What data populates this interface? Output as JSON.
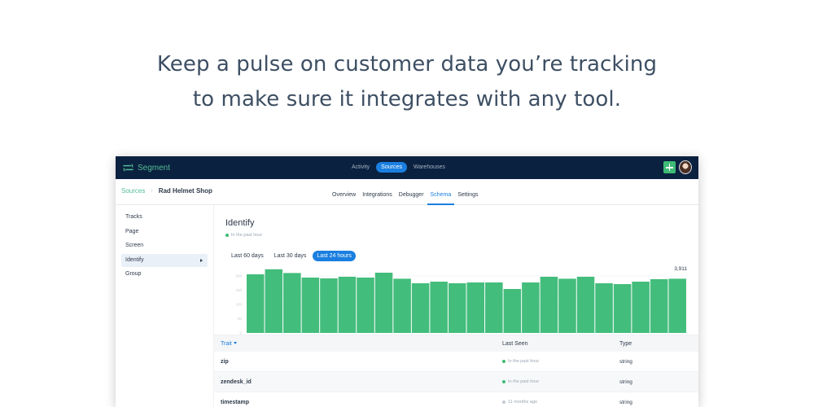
{
  "headline": {
    "line1": "Keep a pulse on customer data you’re tracking",
    "line2": "to make sure it integrates with any tool."
  },
  "topbar": {
    "brand": "Segment",
    "nav": [
      {
        "label": "Activity",
        "active": false
      },
      {
        "label": "Sources",
        "active": true
      },
      {
        "label": "Warehouses",
        "active": false
      }
    ]
  },
  "breadcrumb": {
    "root": "Sources",
    "sep": "›",
    "current": "Rad Helmet Shop"
  },
  "subtabs": [
    {
      "label": "Overview",
      "active": false
    },
    {
      "label": "Integrations",
      "active": false
    },
    {
      "label": "Debugger",
      "active": false
    },
    {
      "label": "Schema",
      "active": true
    },
    {
      "label": "Settings",
      "active": false
    }
  ],
  "sidebar": {
    "items": [
      {
        "label": "Tracks",
        "active": false
      },
      {
        "label": "Page",
        "active": false
      },
      {
        "label": "Screen",
        "active": false
      },
      {
        "label": "Identify",
        "active": true
      },
      {
        "label": "Group",
        "active": false
      }
    ]
  },
  "main": {
    "title": "Identify",
    "status": "In the past hour",
    "ranges": [
      {
        "label": "Last 60 days",
        "active": false
      },
      {
        "label": "Last 30 days",
        "active": false
      },
      {
        "label": "Last 24 hours",
        "active": true
      }
    ]
  },
  "chart_data": {
    "type": "bar",
    "values": [
      3600,
      3911,
      3680,
      3400,
      3350,
      3450,
      3400,
      3700,
      3330,
      3050,
      3150,
      3050,
      3100,
      3100,
      2700,
      3100,
      3450,
      3330,
      3450,
      3050,
      3000,
      3150,
      3300,
      3330
    ],
    "ylim": [
      0,
      4000
    ],
    "max_label": "3,911",
    "tick_labels": [
      "200",
      "150",
      "100",
      "50",
      "0"
    ],
    "color": "#43bd7c"
  },
  "table": {
    "headers": {
      "trait": "Trait",
      "last_seen": "Last Seen",
      "type": "Type"
    },
    "rows": [
      {
        "trait": "zip",
        "last_seen": "In the past hour",
        "type": "string"
      },
      {
        "trait": "zendesk_id",
        "last_seen": "In the past hour",
        "type": "string"
      },
      {
        "trait": "timestamp",
        "last_seen": "11 months ago",
        "type": "string"
      }
    ]
  },
  "colors": {
    "navy": "#0b2140",
    "accent_blue": "#1a7fe0",
    "green": "#3ebb74",
    "brand_green": "#52bd94"
  }
}
